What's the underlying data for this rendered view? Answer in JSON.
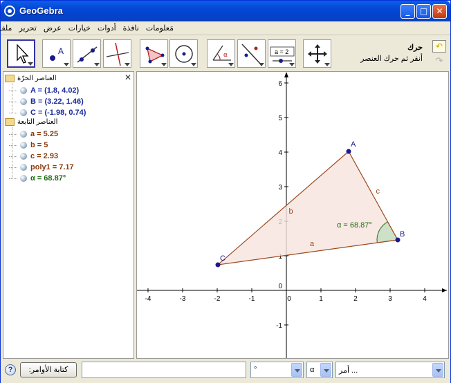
{
  "window": {
    "title": "GeoGebra",
    "min_label": "_",
    "max_label": "□",
    "close_label": "✕"
  },
  "menu": {
    "items": [
      "ملف",
      "تحرير",
      "عرض",
      "خيارات",
      "أدوات",
      "نافذة",
      "مَعلومات"
    ]
  },
  "toolbar": {
    "tool_name": "حرك",
    "tool_help": "أنقر ثم حرك العنصر",
    "slider_label": "a = 2",
    "point_label": "A"
  },
  "algebra": {
    "free_folder": "العناصر الحرّة",
    "dependent_folder": "العناصر التابعة",
    "free_objects": [
      {
        "text": "A = (1.8, 4.02)"
      },
      {
        "text": "B = (3.22, 1.46)"
      },
      {
        "text": "C = (-1.98, 0.74)"
      }
    ],
    "dependent_objects": [
      {
        "text": "a = 5.25"
      },
      {
        "text": "b = 5"
      },
      {
        "text": "c = 2.93"
      },
      {
        "text": "poly1 = 7.17"
      },
      {
        "text": "α = 68.87°"
      }
    ],
    "close_label": "✕"
  },
  "graph": {
    "x_ticks": [
      -4,
      -3,
      -2,
      -1,
      0,
      1,
      2,
      3,
      4
    ],
    "y_ticks": [
      -1,
      0,
      1,
      2,
      3,
      4,
      5,
      6
    ],
    "points": [
      {
        "name": "A",
        "x": 1.8,
        "y": 4.02
      },
      {
        "name": "B",
        "x": 3.22,
        "y": 1.46
      },
      {
        "name": "C",
        "x": -1.98,
        "y": 0.74
      }
    ],
    "segment_labels": {
      "a": "a",
      "b": "b",
      "c": "c"
    },
    "angle_label": "α = 68.87°",
    "colors": {
      "point": "#1a1a8c",
      "polygon_fill": "#f6e3dd",
      "polygon_stroke": "#9c4a1e",
      "angle_fill": "#cfe0c8",
      "angle_stroke": "#2c6b24",
      "angle_text": "#1f6b12"
    }
  },
  "inputbar": {
    "help_label": "?",
    "command_button": "كتابة الأوامر:",
    "input_value": "",
    "symbol1": "°",
    "symbol2": "α",
    "command_placeholder": "أمر ..."
  },
  "colors": {
    "free_text": "#1a2a9c",
    "dependent_text": "#8a3a0c",
    "angle_text": "#1f6b12"
  }
}
